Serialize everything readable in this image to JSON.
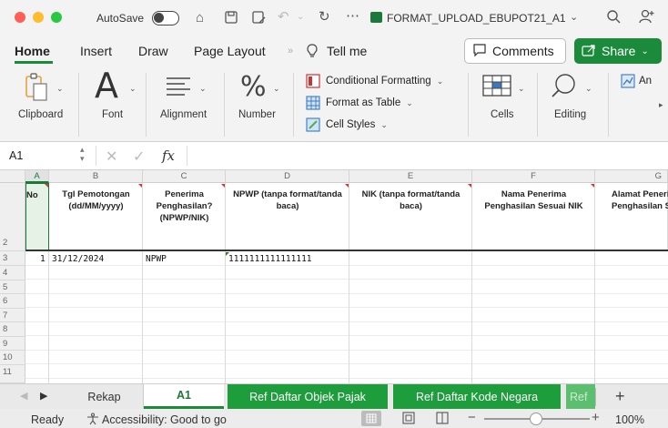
{
  "titlebar": {
    "autosave_label": "AutoSave",
    "file_name": "FORMAT_UPLOAD_EBUPOT21_A1"
  },
  "tabs": {
    "home": "Home",
    "insert": "Insert",
    "draw": "Draw",
    "page_layout": "Page Layout",
    "tell_me": "Tell me",
    "comments": "Comments",
    "share": "Share"
  },
  "ribbon": {
    "clipboard": "Clipboard",
    "font": "Font",
    "alignment": "Alignment",
    "number": "Number",
    "conditional_formatting": "Conditional Formatting",
    "format_as_table": "Format as Table",
    "cell_styles": "Cell Styles",
    "cells": "Cells",
    "editing": "Editing",
    "analyze": "An"
  },
  "formula_bar": {
    "name_box": "A1",
    "fx": "fx"
  },
  "grid": {
    "columns": [
      "A",
      "B",
      "C",
      "D",
      "E",
      "F",
      "G"
    ],
    "rows": [
      "2",
      "3",
      "4",
      "5",
      "6",
      "7",
      "8",
      "9",
      "10",
      "11"
    ],
    "headers": {
      "a": "No",
      "b": "Tgl Pemotongan (dd/MM/yyyy)",
      "c": "Penerima Penghasilan? (NPWP/NIK)",
      "d": "NPWP (tanpa format/tanda baca)",
      "e": "NIK (tanpa format/tanda baca)",
      "f": "Nama Penerima Penghasilan Sesuai NIK",
      "g": "Alamat Penerima Penghasilan Sesuai NIK"
    },
    "row3": {
      "a": "1",
      "b": "31/12/2024",
      "c": "NPWP",
      "d": "1111111111111111"
    }
  },
  "sheets": {
    "tabs": [
      "Rekap",
      "A1",
      "Ref Daftar Objek Pajak",
      "Ref Daftar Kode Negara",
      "Ref"
    ],
    "add": "+"
  },
  "status": {
    "ready": "Ready",
    "accessibility": "Accessibility: Good to go",
    "zoom": "100%"
  },
  "colors": {
    "accent_green": "#1b8a3a",
    "sheet_tab_green": "#1e9d3c"
  }
}
